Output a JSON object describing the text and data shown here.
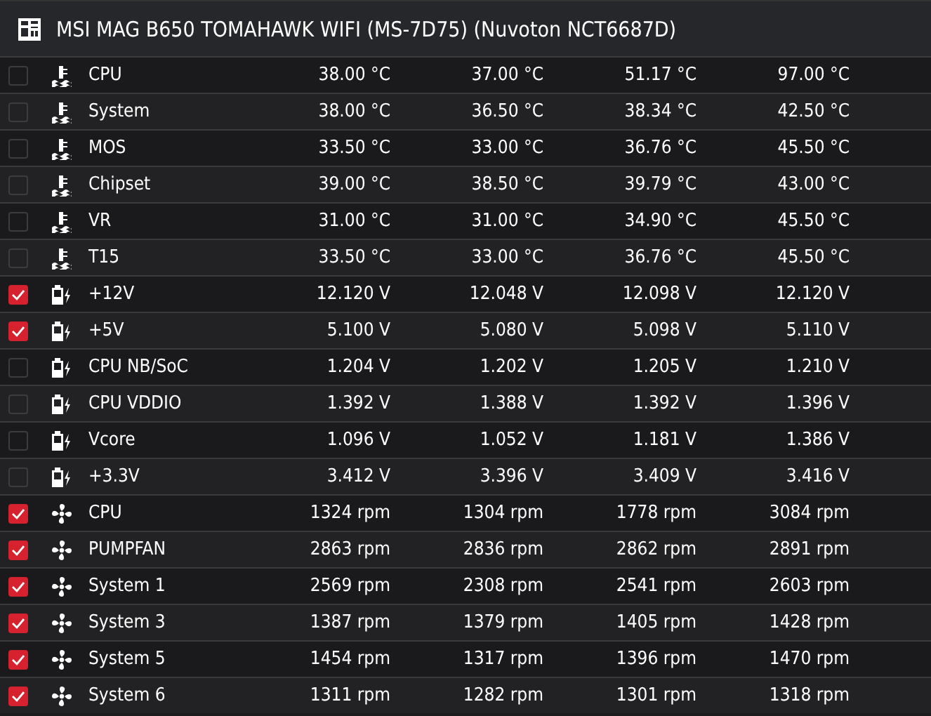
{
  "header": {
    "title": "MSI MAG B650 TOMAHAWK WIFI (MS-7D75) (Nuvoton NCT6687D)"
  },
  "rows": [
    {
      "kind": "temperature",
      "checked": false,
      "name": "CPU",
      "values": [
        "38.00 °C",
        "37.00 °C",
        "51.17 °C",
        "97.00 °C"
      ]
    },
    {
      "kind": "temperature",
      "checked": false,
      "name": "System",
      "values": [
        "38.00 °C",
        "36.50 °C",
        "38.34 °C",
        "42.50 °C"
      ]
    },
    {
      "kind": "temperature",
      "checked": false,
      "name": "MOS",
      "values": [
        "33.50 °C",
        "33.00 °C",
        "36.76 °C",
        "45.50 °C"
      ]
    },
    {
      "kind": "temperature",
      "checked": false,
      "name": "Chipset",
      "values": [
        "39.00 °C",
        "38.50 °C",
        "39.79 °C",
        "43.00 °C"
      ]
    },
    {
      "kind": "temperature",
      "checked": false,
      "name": "VR",
      "values": [
        "31.00 °C",
        "31.00 °C",
        "34.90 °C",
        "45.50 °C"
      ]
    },
    {
      "kind": "temperature",
      "checked": false,
      "name": "T15",
      "values": [
        "33.50 °C",
        "33.00 °C",
        "36.76 °C",
        "45.50 °C"
      ]
    },
    {
      "kind": "voltage",
      "checked": true,
      "name": "+12V",
      "values": [
        "12.120 V",
        "12.048 V",
        "12.098 V",
        "12.120 V"
      ]
    },
    {
      "kind": "voltage",
      "checked": true,
      "name": "+5V",
      "values": [
        "5.100 V",
        "5.080 V",
        "5.098 V",
        "5.110 V"
      ]
    },
    {
      "kind": "voltage",
      "checked": false,
      "name": "CPU NB/SoC",
      "values": [
        "1.204 V",
        "1.202 V",
        "1.205 V",
        "1.210 V"
      ]
    },
    {
      "kind": "voltage",
      "checked": false,
      "name": "CPU VDDIO",
      "values": [
        "1.392 V",
        "1.388 V",
        "1.392 V",
        "1.396 V"
      ]
    },
    {
      "kind": "voltage",
      "checked": false,
      "name": "Vcore",
      "values": [
        "1.096 V",
        "1.052 V",
        "1.181 V",
        "1.386 V"
      ]
    },
    {
      "kind": "voltage",
      "checked": false,
      "name": "+3.3V",
      "values": [
        "3.412 V",
        "3.396 V",
        "3.409 V",
        "3.416 V"
      ]
    },
    {
      "kind": "fan",
      "checked": true,
      "name": "CPU",
      "values": [
        "1324 rpm",
        "1304 rpm",
        "1778 rpm",
        "3084 rpm"
      ]
    },
    {
      "kind": "fan",
      "checked": true,
      "name": "PUMPFAN",
      "values": [
        "2863 rpm",
        "2836 rpm",
        "2862 rpm",
        "2891 rpm"
      ]
    },
    {
      "kind": "fan",
      "checked": true,
      "name": "System 1",
      "values": [
        "2569 rpm",
        "2308 rpm",
        "2541 rpm",
        "2603 rpm"
      ]
    },
    {
      "kind": "fan",
      "checked": true,
      "name": "System 3",
      "values": [
        "1387 rpm",
        "1379 rpm",
        "1405 rpm",
        "1428 rpm"
      ]
    },
    {
      "kind": "fan",
      "checked": true,
      "name": "System 5",
      "values": [
        "1454 rpm",
        "1317 rpm",
        "1396 rpm",
        "1470 rpm"
      ]
    },
    {
      "kind": "fan",
      "checked": true,
      "name": "System 6",
      "values": [
        "1311 rpm",
        "1282 rpm",
        "1301 rpm",
        "1318 rpm"
      ]
    }
  ]
}
